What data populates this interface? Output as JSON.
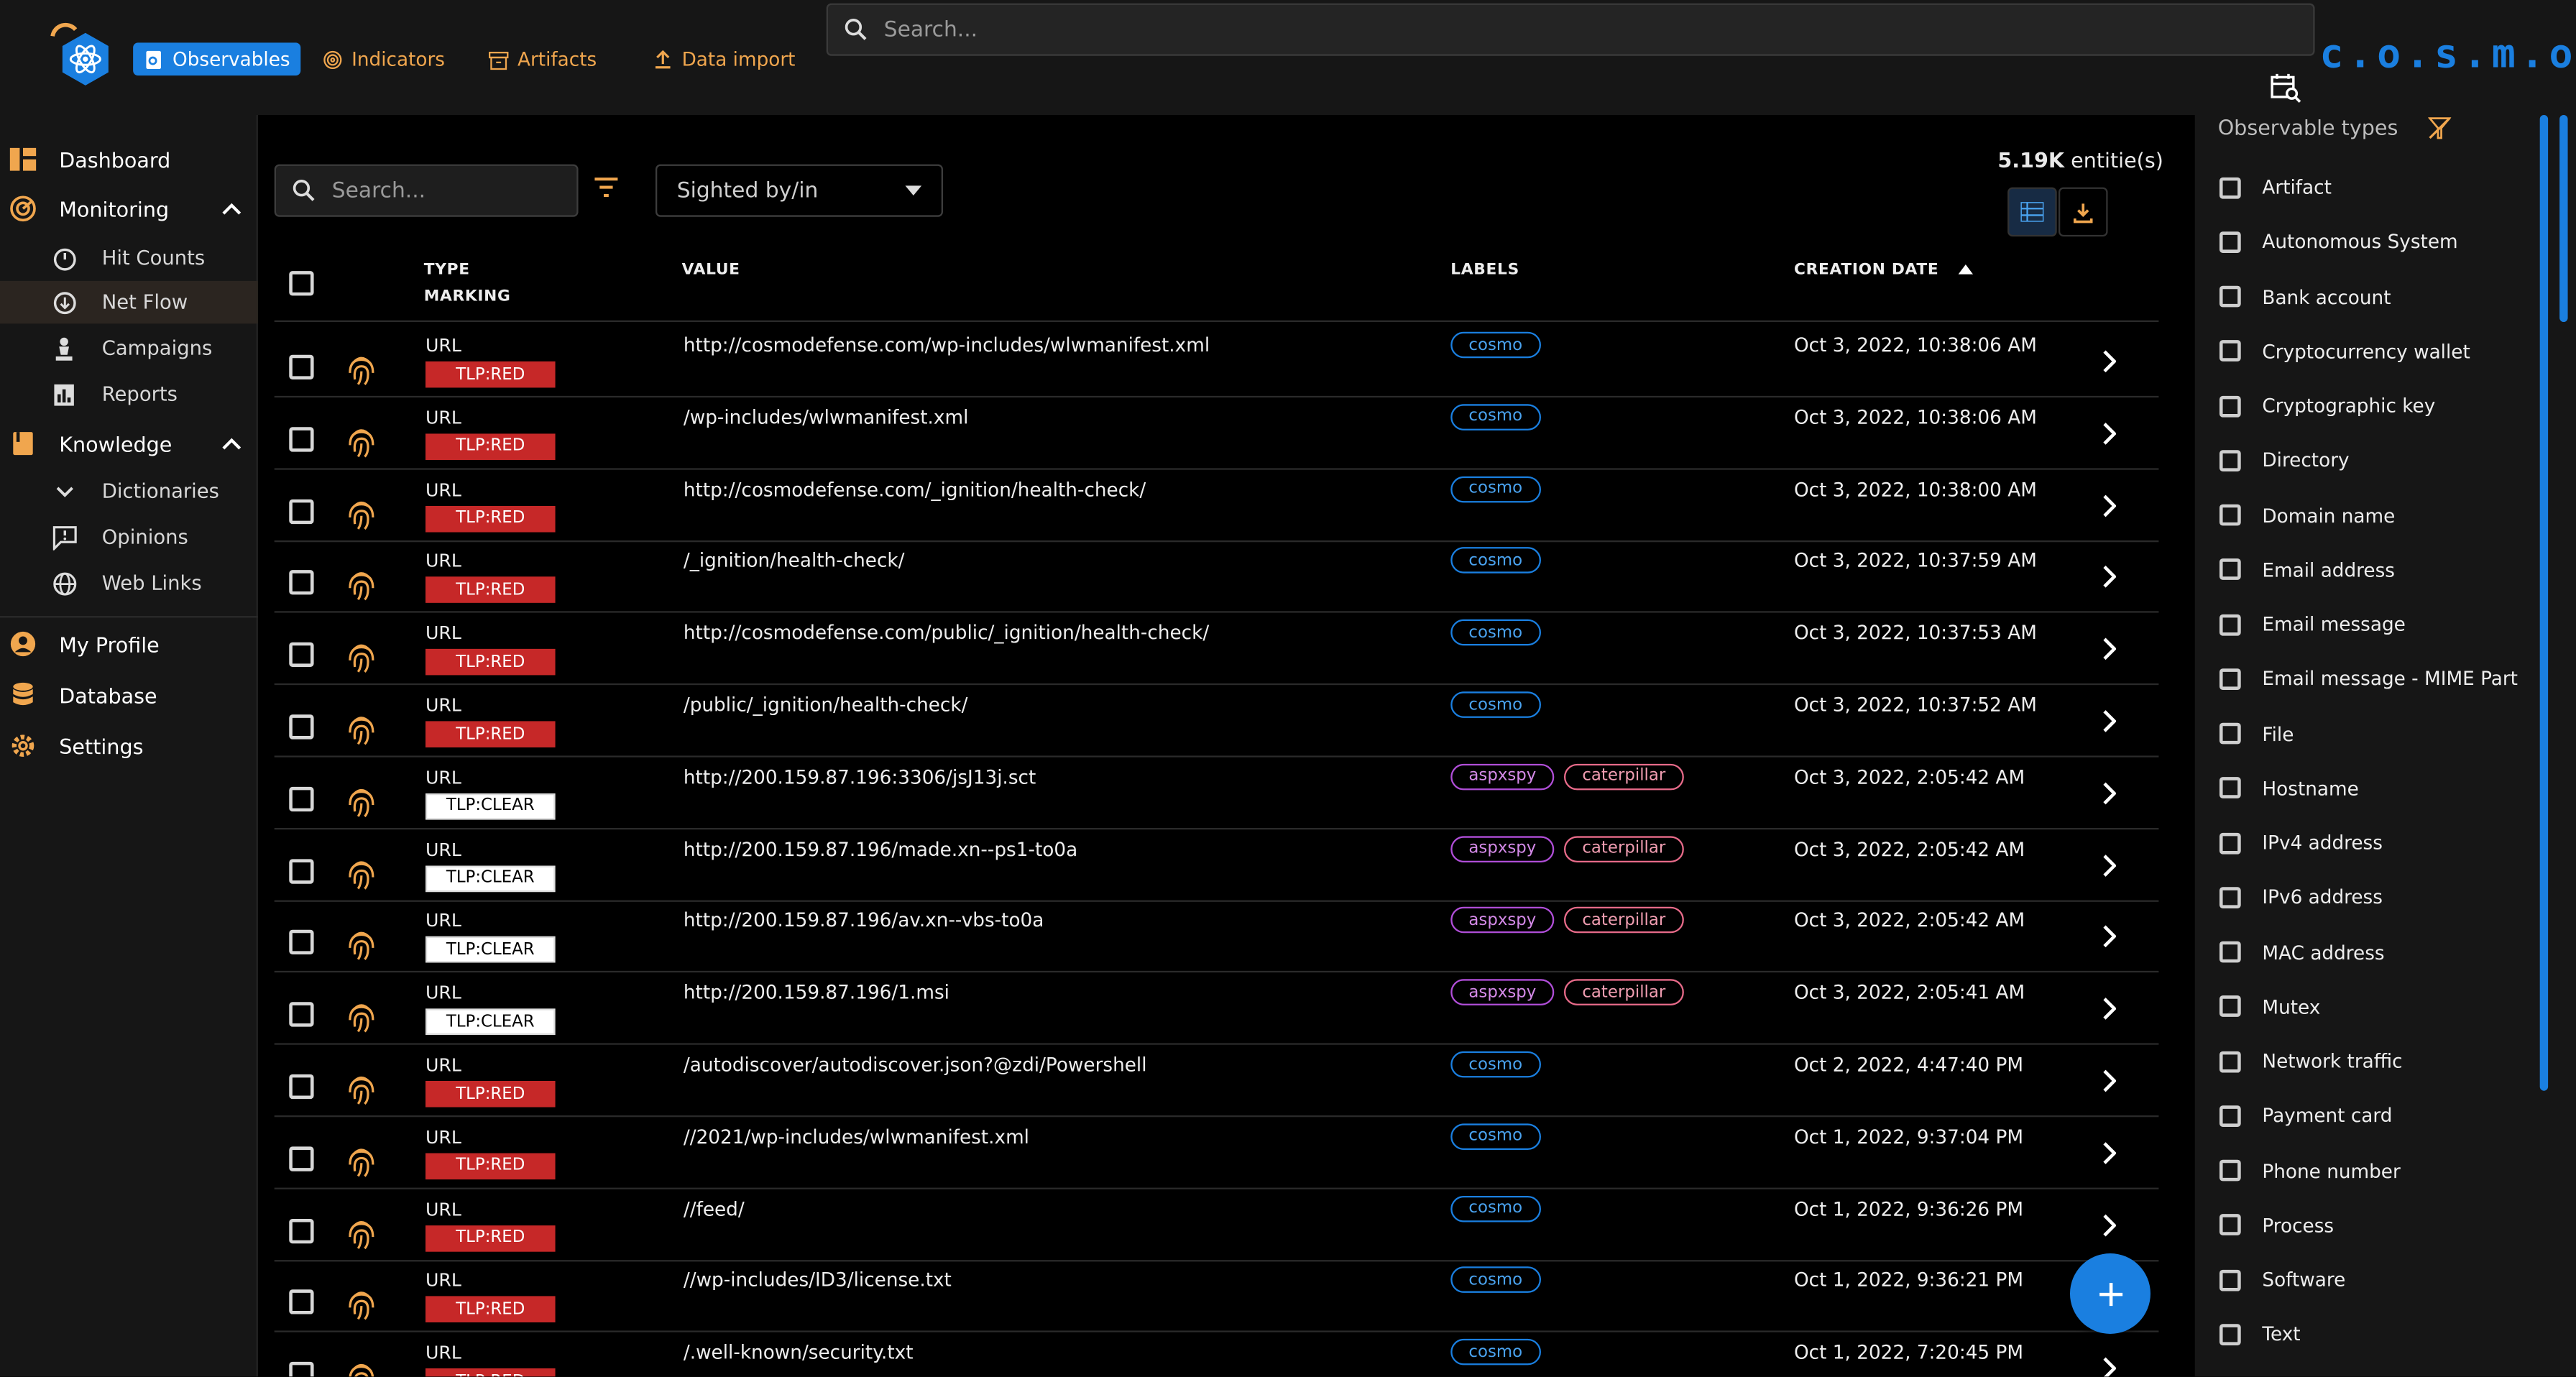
{
  "nav": {
    "items": [
      {
        "label": "Observables",
        "active": true
      },
      {
        "label": "Indicators"
      },
      {
        "label": "Artifacts"
      },
      {
        "label": "Data import"
      }
    ],
    "search_placeholder": "Search...",
    "brand": "c.o.s.m.o"
  },
  "sidebar": {
    "dashboard": "Dashboard",
    "monitoring": "Monitoring",
    "hit_counts": "Hit Counts",
    "net_flow": "Net Flow",
    "campaigns": "Campaigns",
    "reports": "Reports",
    "knowledge": "Knowledge",
    "dictionaries": "Dictionaries",
    "opinions": "Opinions",
    "web_links": "Web Links",
    "my_profile": "My Profile",
    "database": "Database",
    "settings": "Settings"
  },
  "toolbar": {
    "search_placeholder": "Search...",
    "sighted": "Sighted by/in",
    "count_value": "5.19K",
    "count_unit": " entitie(s)"
  },
  "table": {
    "col_type": "TYPE",
    "col_marking": "MARKING",
    "col_value": "VALUE",
    "col_labels": "LABELS",
    "col_date": "CREATION DATE",
    "rows": [
      {
        "type": "URL",
        "tlp": "TLP:RED",
        "value": "http://cosmodefense.com/wp-includes/wlwmanifest.xml",
        "labels": [
          "cosmo"
        ],
        "date": "Oct 3, 2022, 10:38:06 AM"
      },
      {
        "type": "URL",
        "tlp": "TLP:RED",
        "value": "/wp-includes/wlwmanifest.xml",
        "labels": [
          "cosmo"
        ],
        "date": "Oct 3, 2022, 10:38:06 AM"
      },
      {
        "type": "URL",
        "tlp": "TLP:RED",
        "value": "http://cosmodefense.com/_ignition/health-check/",
        "labels": [
          "cosmo"
        ],
        "date": "Oct 3, 2022, 10:38:00 AM"
      },
      {
        "type": "URL",
        "tlp": "TLP:RED",
        "value": "/_ignition/health-check/",
        "labels": [
          "cosmo"
        ],
        "date": "Oct 3, 2022, 10:37:59 AM"
      },
      {
        "type": "URL",
        "tlp": "TLP:RED",
        "value": "http://cosmodefense.com/public/_ignition/health-check/",
        "labels": [
          "cosmo"
        ],
        "date": "Oct 3, 2022, 10:37:53 AM"
      },
      {
        "type": "URL",
        "tlp": "TLP:RED",
        "value": "/public/_ignition/health-check/",
        "labels": [
          "cosmo"
        ],
        "date": "Oct 3, 2022, 10:37:52 AM"
      },
      {
        "type": "URL",
        "tlp": "TLP:CLEAR",
        "value": "http://200.159.87.196:3306/jsJ13j.sct",
        "labels": [
          "aspxspy",
          "caterpillar"
        ],
        "date": "Oct 3, 2022, 2:05:42 AM"
      },
      {
        "type": "URL",
        "tlp": "TLP:CLEAR",
        "value": "http://200.159.87.196/made.xn--ps1-to0a",
        "labels": [
          "aspxspy",
          "caterpillar"
        ],
        "date": "Oct 3, 2022, 2:05:42 AM"
      },
      {
        "type": "URL",
        "tlp": "TLP:CLEAR",
        "value": "http://200.159.87.196/av.xn--vbs-to0a",
        "labels": [
          "aspxspy",
          "caterpillar"
        ],
        "date": "Oct 3, 2022, 2:05:42 AM"
      },
      {
        "type": "URL",
        "tlp": "TLP:CLEAR",
        "value": "http://200.159.87.196/1.msi",
        "labels": [
          "aspxspy",
          "caterpillar"
        ],
        "date": "Oct 3, 2022, 2:05:41 AM"
      },
      {
        "type": "URL",
        "tlp": "TLP:RED",
        "value": "/autodiscover/autodiscover.json?@zdi/Powershell",
        "labels": [
          "cosmo"
        ],
        "date": "Oct 2, 2022, 4:47:40 PM"
      },
      {
        "type": "URL",
        "tlp": "TLP:RED",
        "value": "//2021/wp-includes/wlwmanifest.xml",
        "labels": [
          "cosmo"
        ],
        "date": "Oct 1, 2022, 9:37:04 PM"
      },
      {
        "type": "URL",
        "tlp": "TLP:RED",
        "value": "//feed/",
        "labels": [
          "cosmo"
        ],
        "date": "Oct 1, 2022, 9:36:26 PM"
      },
      {
        "type": "URL",
        "tlp": "TLP:RED",
        "value": "//wp-includes/ID3/license.txt",
        "labels": [
          "cosmo"
        ],
        "date": "Oct 1, 2022, 9:36:21 PM"
      },
      {
        "type": "URL",
        "tlp": "TLP:RED",
        "value": "/.well-known/security.txt",
        "labels": [
          "cosmo"
        ],
        "date": "Oct 1, 2022, 7:20:45 PM"
      }
    ]
  },
  "right_panel": {
    "title": "Observable types",
    "types": [
      "Artifact",
      "Autonomous System",
      "Bank account",
      "Cryptocurrency wallet",
      "Cryptographic key",
      "Directory",
      "Domain name",
      "Email address",
      "Email message",
      "Email message - MIME Part",
      "File",
      "Hostname",
      "IPv4 address",
      "IPv6 address",
      "MAC address",
      "Mutex",
      "Network traffic",
      "Payment card",
      "Phone number",
      "Process",
      "Software",
      "Text"
    ]
  },
  "colors": {
    "accent": "#1a7fe0",
    "orange": "#f0a64e",
    "tlp_red": "#c62828"
  }
}
